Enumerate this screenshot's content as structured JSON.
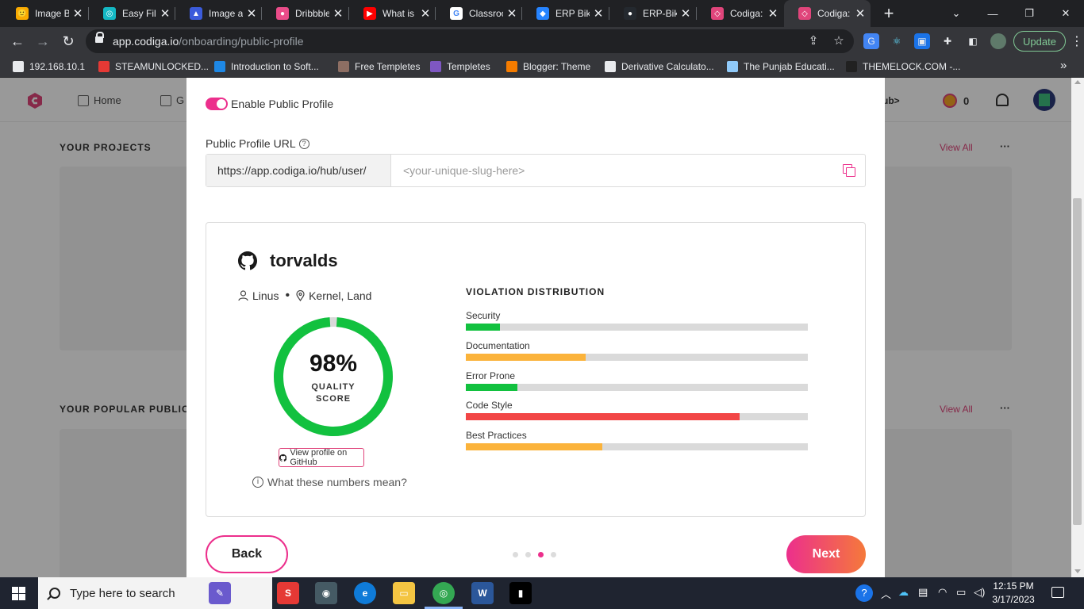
{
  "browser": {
    "tabs": [
      {
        "title": "Image B",
        "color": "#f9ab00",
        "glyph": "🙂"
      },
      {
        "title": "Easy File",
        "color": "#14b8c4",
        "glyph": "◎"
      },
      {
        "title": "Image an",
        "color": "#3b5bdb",
        "glyph": "▲"
      },
      {
        "title": "Dribbble",
        "color": "#ea4c89",
        "glyph": "●"
      },
      {
        "title": "What is",
        "color": "#ff0000",
        "glyph": "▶"
      },
      {
        "title": "Classroo",
        "color": "#ffffff",
        "glyph": "G"
      },
      {
        "title": "ERP Bike",
        "color": "#2684ff",
        "glyph": "◆"
      },
      {
        "title": "ERP-Bike",
        "color": "#24292f",
        "glyph": "●"
      },
      {
        "title": "Codiga:",
        "color": "#e0457b",
        "glyph": "◇"
      },
      {
        "title": "Codiga:",
        "color": "#e0457b",
        "glyph": "◇",
        "active": true
      }
    ],
    "url_host": "app.codiga.io",
    "url_path": "/onboarding/public-profile",
    "update_label": "Update",
    "bookmarks": [
      {
        "label": "192.168.10.1",
        "color": "#e8eaed"
      },
      {
        "label": "STEAMUNLOCKED...",
        "color": "#e53935"
      },
      {
        "label": "Introduction to Soft...",
        "color": "#1e88e5"
      },
      {
        "label": "Free Templetes",
        "color": "#8d6e63"
      },
      {
        "label": "Templetes",
        "color": "#7e57c2"
      },
      {
        "label": "Blogger: Theme",
        "color": "#f57c00"
      },
      {
        "label": "Derivative Calculato...",
        "color": "#e8eaed"
      },
      {
        "label": "The Punjab Educati...",
        "color": "#90caf9"
      },
      {
        "label": "THEMELOCK.COM -...",
        "color": "#212121"
      }
    ]
  },
  "app": {
    "nav_home": "Home",
    "nav_second": "G",
    "hub_label": "ub>",
    "coin_count": "0",
    "projects_title": "YOUR PROJECTS",
    "popular_title": "YOUR POPULAR PUBLIC S",
    "view_all": "View All",
    "more": "···"
  },
  "modal": {
    "toggle_label": "Enable Public Profile",
    "toggle_on": true,
    "url_label": "Public Profile URL",
    "url_prefix": "https://app.codiga.io/hub/user/",
    "slug_placeholder": "<your-unique-slug-here>",
    "slug_value": "",
    "profile": {
      "username": "torvalds",
      "name": "Linus",
      "location": "Kernel, Land",
      "score": 98,
      "score_text": "98%",
      "score_label_1": "QUALITY",
      "score_label_2": "SCORE",
      "github_button": "View profile on GitHub",
      "numbers_link": "What these numbers mean?"
    },
    "violations": {
      "title": "VIOLATION DISTRIBUTION",
      "items": [
        {
          "label": "Security",
          "fraction": 0.1,
          "color": "#12c13f"
        },
        {
          "label": "Documentation",
          "fraction": 0.35,
          "color": "#fbb33b"
        },
        {
          "label": "Error Prone",
          "fraction": 0.15,
          "color": "#12c13f"
        },
        {
          "label": "Code Style",
          "fraction": 0.8,
          "color": "#f24646"
        },
        {
          "label": "Best Practices",
          "fraction": 0.4,
          "color": "#fbb33b"
        }
      ]
    },
    "back_label": "Back",
    "next_label": "Next",
    "steps": 4,
    "active_step": 3
  },
  "taskbar": {
    "search_placeholder": "Type here to search",
    "time": "12:15 PM",
    "date": "3/17/2023"
  }
}
